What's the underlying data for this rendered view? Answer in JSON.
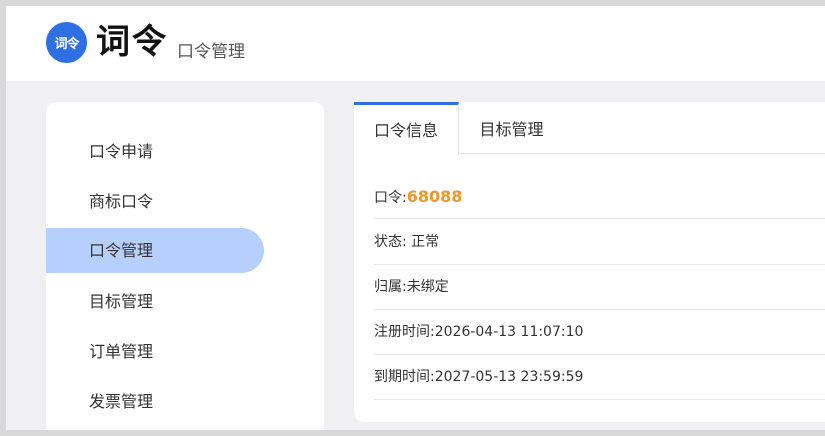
{
  "header": {
    "logo_badge": "词令",
    "logo_text": "词令",
    "subtitle": "口令管理",
    "brand_color": "#2f6fe4"
  },
  "sidebar": {
    "items": [
      {
        "label": "口令申请"
      },
      {
        "label": "商标口令"
      },
      {
        "label": "口令管理",
        "active": true
      },
      {
        "label": "目标管理"
      },
      {
        "label": "订单管理"
      },
      {
        "label": "发票管理"
      }
    ],
    "active_color": "#b7cffc"
  },
  "tabs": [
    {
      "label": "口令信息",
      "active": true
    },
    {
      "label": "目标管理"
    }
  ],
  "info": {
    "code_label": "口令:",
    "code_value": "68088",
    "status_label": "状态:",
    "status_value": "正常",
    "owner_label": "归属:",
    "owner_value": "未绑定",
    "registered_label": "注册时间:",
    "registered_value": "2026-04-13 11:07:10",
    "expires_label": "到期时间:",
    "expires_value": "2027-05-13 23:59:59",
    "code_color": "#f0962c"
  }
}
